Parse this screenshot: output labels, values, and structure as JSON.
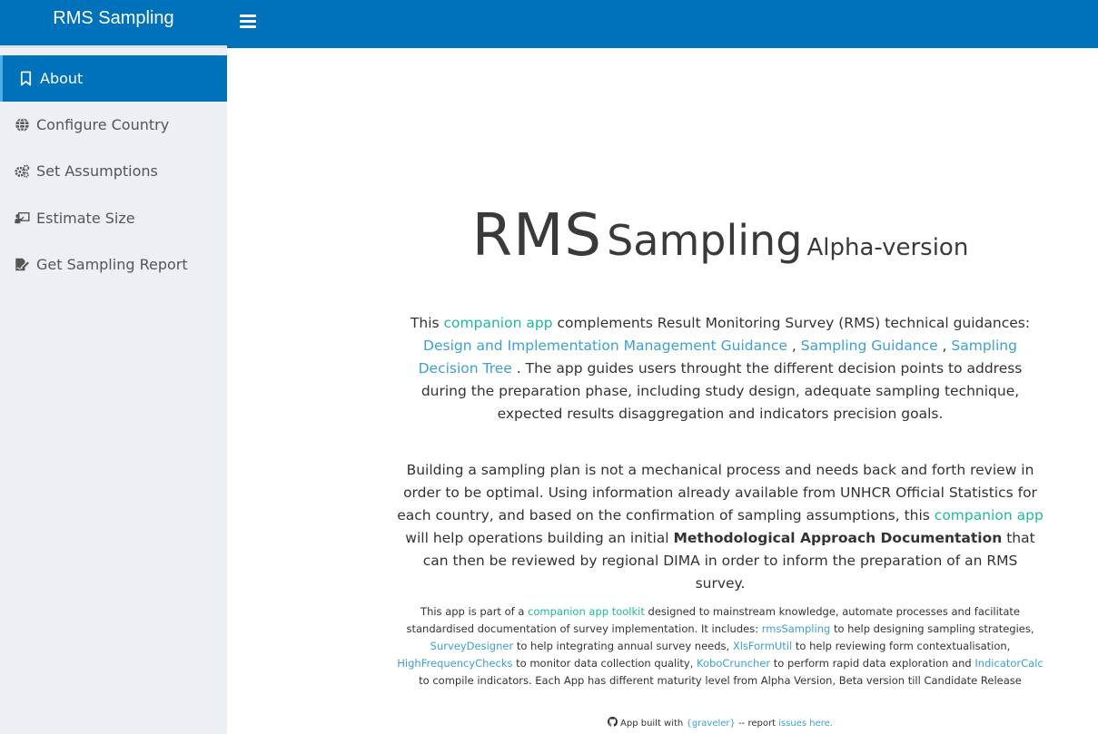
{
  "header": {
    "brand": "RMS Sampling",
    "toggle_icon": "bars-icon",
    "brand_color": "#0072bc"
  },
  "sidebar": {
    "items": [
      {
        "label": "About",
        "icon": "bookmark-icon",
        "active": true
      },
      {
        "label": "Configure Country",
        "icon": "globe-icon",
        "active": false
      },
      {
        "label": "Set Assumptions",
        "icon": "cogs-icon",
        "active": false
      },
      {
        "label": "Estimate Size",
        "icon": "chalkboard-icon",
        "active": false
      },
      {
        "label": "Get Sampling Report",
        "icon": "file-signature-icon",
        "active": false
      }
    ]
  },
  "main": {
    "title": "RMS",
    "subtitle": "Sampling",
    "version": "Alpha-version",
    "p1": {
      "t1": "This ",
      "link1": "companion app",
      "t2": " complements Result Monitoring Survey (RMS) technical guidances: ",
      "link2": "Design and Implementation Management Guidance",
      "t3": " , ",
      "link3": "Sampling Guidance",
      "t4": " , ",
      "link4": "Sampling Decision Tree",
      "t5": " . The app guides users throught the different decision points to address during the preparation phase, including study design, adequate sampling technique, expected results disaggregation and indicators precision goals."
    },
    "p2": {
      "t1": "Building a sampling plan is not a mechanical process and needs back and forth review in order to be optimal. Using information already available from UNHCR Official Statistics for each country, and based on the confirmation of sampling assumptions, this ",
      "link1": "companion app",
      "t2": " will help operations building an initial ",
      "bold": "Methodological Approach Documentation",
      "t3": " that can then be reviewed by regional DIMA in order to inform the preparation of an RMS survey."
    },
    "p3": {
      "t1": "This app is part of a ",
      "link1": "companion app toolkit",
      "t2": " designed to mainstream knowledge, automate processes and facilitate standardised documentation of survey implementation. It includes: ",
      "link2": "rmsSampling",
      "t3": " to help designing sampling strategies, ",
      "link3": "SurveyDesigner",
      "t4": " to help integrating annual survey needs, ",
      "link4": "XlsFormUtil",
      "t5": " to help reviewing form contextualisation, ",
      "link5": "HighFrequencyChecks",
      "t6": " to monitor data collection quality, ",
      "link6": "KoboCruncher",
      "t7": " to perform rapid data exploration and ",
      "link7": "IndicatorCalc",
      "t8": " to compile indicators. Each App has different maturity level from Alpha Version, Beta version till Candidate Release"
    },
    "footer": {
      "icon": "github-icon",
      "t1": "App built with ",
      "link1": "{graveler}",
      "t2": " -- report ",
      "link2": "issues here."
    }
  }
}
